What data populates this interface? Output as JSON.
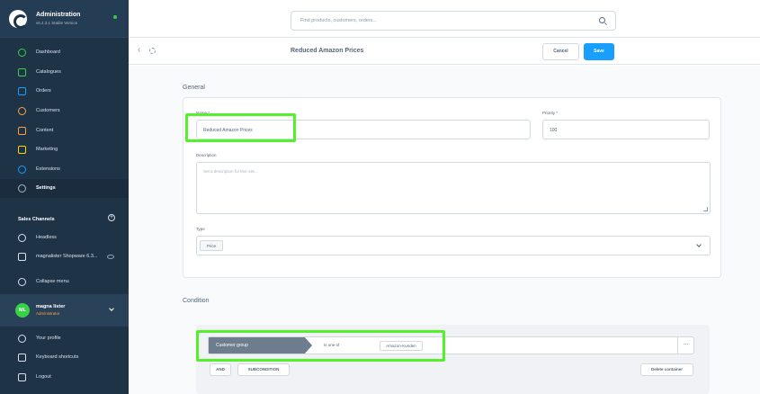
{
  "app": {
    "title": "Administration",
    "version": "v6.4.3.1 Stable Version"
  },
  "sidebar": {
    "items": [
      {
        "label": "Dashboard",
        "icon": "gauge-icon",
        "color": "#37d046"
      },
      {
        "label": "Catalogues",
        "icon": "catalog-icon",
        "color": "#37d046"
      },
      {
        "label": "Orders",
        "icon": "orders-icon",
        "color": "#189eff"
      },
      {
        "label": "Customers",
        "icon": "customers-icon",
        "color": "#ff9f45"
      },
      {
        "label": "Content",
        "icon": "content-icon",
        "color": "#ff9f45"
      },
      {
        "label": "Marketing",
        "icon": "marketing-icon",
        "color": "#ffd700"
      },
      {
        "label": "Extensions",
        "icon": "extensions-icon",
        "color": "#189eff"
      },
      {
        "label": "Settings",
        "icon": "settings-icon",
        "color": "#a9b9c8"
      }
    ],
    "sales_channels_title": "Sales Channels",
    "channels": [
      {
        "label": "Headless"
      },
      {
        "label": "magnalister Shopware 6.3..."
      }
    ],
    "collapse_label": "Collapse menu",
    "user": {
      "initials": "ML",
      "name": "magna lister",
      "role": "Administrator"
    },
    "bottom": [
      {
        "label": "Your profile"
      },
      {
        "label": "Keyboard shortcuts"
      },
      {
        "label": "Logout"
      }
    ]
  },
  "search": {
    "placeholder": "Find products, customers, orders..."
  },
  "smartbar": {
    "title": "Reduced Amazon Prices",
    "cancel_label": "Cancel",
    "save_label": "Save"
  },
  "general": {
    "section_title": "General",
    "name_label": "Name *",
    "name_value": "Reduced Amazon Prices",
    "priority_label": "Priority *",
    "priority_value": "100",
    "description_label": "Description",
    "description_placeholder": "Set a description for this rule...",
    "type_label": "Type",
    "type_chip": "Price"
  },
  "condition": {
    "section_title": "Condition",
    "field": "Customer group",
    "operator": "Is one of",
    "value_chip": "Amazon-Kunden",
    "more": "...",
    "and_label": "AND",
    "subcondition_label": "SUBCONDITION",
    "delete_label": "Delete container"
  },
  "colors": {
    "sidebar_bg": "#1f3346",
    "accent": "#189eff",
    "highlight": "#54f02c"
  }
}
